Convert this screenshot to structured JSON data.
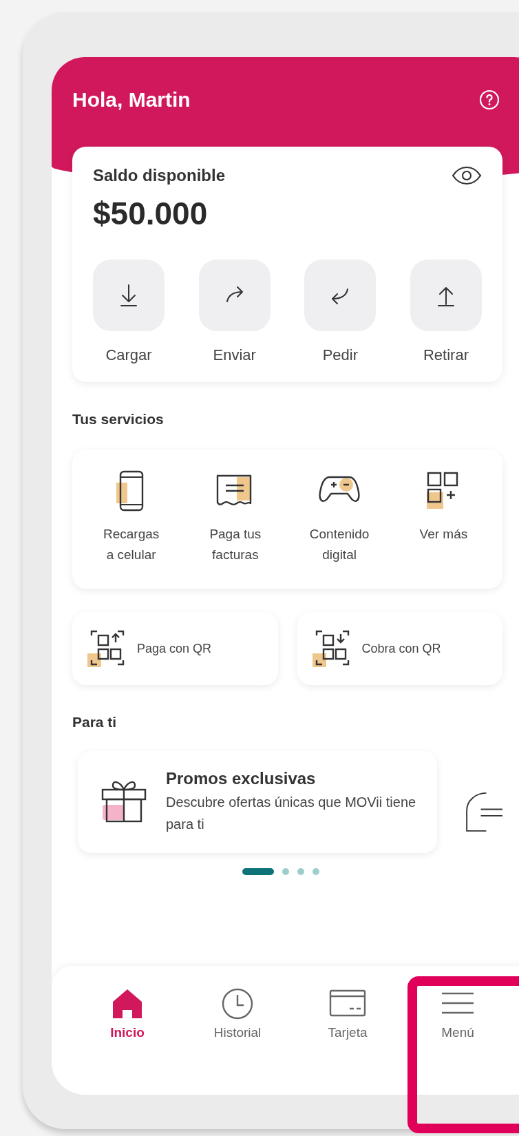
{
  "header": {
    "greeting": "Hola, Martin"
  },
  "balance": {
    "label": "Saldo disponible",
    "amount": "$50.000"
  },
  "actions": [
    {
      "label": "Cargar"
    },
    {
      "label": "Enviar"
    },
    {
      "label": "Pedir"
    },
    {
      "label": "Retirar"
    }
  ],
  "services_title": "Tus servicios",
  "services": [
    {
      "label": "Recargas\na celular"
    },
    {
      "label": "Paga tus\nfacturas"
    },
    {
      "label": "Contenido\ndigital"
    },
    {
      "label": "Ver más"
    }
  ],
  "qr_actions": [
    {
      "label": "Paga con QR"
    },
    {
      "label": "Cobra con QR"
    }
  ],
  "for_you_title": "Para ti",
  "promo": {
    "title": "Promos exclusivas",
    "text": "Descubre ofertas únicas que MOVii tiene para ti"
  },
  "carousel_dots": [
    {
      "selected": true
    },
    {
      "selected": false
    },
    {
      "selected": false
    },
    {
      "selected": false
    }
  ],
  "nav": [
    {
      "label": "Inicio",
      "selected": true
    },
    {
      "label": "Historial",
      "selected": false
    },
    {
      "label": "Tarjeta",
      "selected": false
    },
    {
      "label": "Menú",
      "selected": false
    }
  ]
}
